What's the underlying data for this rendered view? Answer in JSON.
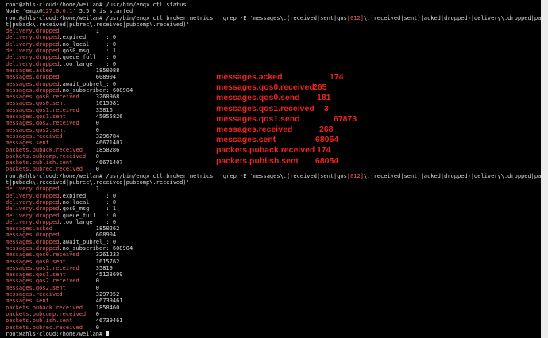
{
  "terminal": {
    "lines": [
      {
        "segs": [
          {
            "t": "root@ahls-cloud:/home/weilan# /usr/bin/emqx ctl status"
          }
        ]
      },
      {
        "segs": [
          {
            "t": "Node 'emqx@"
          },
          {
            "t": "127.0.0.1",
            "c": "r"
          },
          {
            "t": "' 5.5.0 is started"
          }
        ]
      },
      {
        "segs": [
          {
            "t": "root@ahls-cloud:/home/weilan# /usr/bin/emqx ctl broker metrics | grep -E 'messages\\.(received|sent|qos"
          },
          {
            "t": "[012]",
            "c": "r"
          },
          {
            "t": "\\.(received|sent)|acked|dropped)|delivery\\.dropped|packets\\.(publish\\.sent|"
          }
        ]
      },
      {
        "segs": [
          {
            "t": "t|puback\\.received|pubrec\\.received|pubcomp\\.received)'"
          }
        ]
      },
      {
        "segs": [
          {
            "t": "delivery.dropped",
            "c": "r"
          },
          {
            "t": "         : 1"
          }
        ]
      },
      {
        "segs": [
          {
            "t": "delivery.dropped",
            "c": "r"
          },
          {
            "t": ".expired      : 0"
          }
        ]
      },
      {
        "segs": [
          {
            "t": "delivery.dropped",
            "c": "r"
          },
          {
            "t": ".no_local     : 0"
          }
        ]
      },
      {
        "segs": [
          {
            "t": "delivery.dropped",
            "c": "r"
          },
          {
            "t": ".qos0_msg     : 1"
          }
        ]
      },
      {
        "segs": [
          {
            "t": "delivery.dropped",
            "c": "r"
          },
          {
            "t": ".queue_full   : 0"
          }
        ]
      },
      {
        "segs": [
          {
            "t": "delivery.dropped",
            "c": "r"
          },
          {
            "t": ".too_large    : 0"
          }
        ]
      },
      {
        "segs": [
          {
            "t": "messages.acked",
            "c": "r"
          },
          {
            "t": "           : 1850088"
          }
        ]
      },
      {
        "segs": [
          {
            "t": "messages.dropped",
            "c": "r"
          },
          {
            "t": "         : 608904"
          }
        ]
      },
      {
        "segs": [
          {
            "t": "messages.dropped",
            "c": "r"
          },
          {
            "t": ".await_pubrel_: 0"
          }
        ]
      },
      {
        "segs": [
          {
            "t": "messages.dropped",
            "c": "r"
          },
          {
            "t": ".no_subscriber: 608904"
          }
        ]
      },
      {
        "segs": [
          {
            "t": "messages.qos0.received",
            "c": "r"
          },
          {
            "t": "   : 3260968"
          }
        ]
      },
      {
        "segs": [
          {
            "t": "messages.qos0.sent",
            "c": "r"
          },
          {
            "t": "       : 1615581"
          }
        ]
      },
      {
        "segs": [
          {
            "t": "messages.qos1.received",
            "c": "r"
          },
          {
            "t": "   : 35816"
          }
        ]
      },
      {
        "segs": [
          {
            "t": "messages.qos1.sent",
            "c": "r"
          },
          {
            "t": "       : 45055826"
          }
        ]
      },
      {
        "segs": [
          {
            "t": "messages.qos2.received",
            "c": "r"
          },
          {
            "t": "   : 0"
          }
        ]
      },
      {
        "segs": [
          {
            "t": "messages.qos2.sent",
            "c": "r"
          },
          {
            "t": "       : 0"
          }
        ]
      },
      {
        "segs": [
          {
            "t": "messages.received",
            "c": "r"
          },
          {
            "t": "        : 3296784"
          }
        ]
      },
      {
        "segs": [
          {
            "t": "messages.sent",
            "c": "r"
          },
          {
            "t": "            : 46671407"
          }
        ]
      },
      {
        "segs": [
          {
            "t": "packets.puback.received",
            "c": "r"
          },
          {
            "t": "  : 1858286"
          }
        ]
      },
      {
        "segs": [
          {
            "t": "packets.pubcomp.received",
            "c": "r"
          },
          {
            "t": " : 0"
          }
        ]
      },
      {
        "segs": [
          {
            "t": "packets.publish.sent",
            "c": "r"
          },
          {
            "t": "     : 46671407"
          }
        ]
      },
      {
        "segs": [
          {
            "t": "packets.pubrec.received",
            "c": "r"
          },
          {
            "t": "  : 0"
          }
        ]
      },
      {
        "segs": [
          {
            "t": "root@ahls-cloud:/home/weilan# /usr/bin/emqx ctl broker metrics | grep -E 'messages\\.(received|sent|qos"
          },
          {
            "t": "[012]",
            "c": "r"
          },
          {
            "t": "\\.(received|sent)|acked|dropped)|delivery\\.dropped|packets\\.(publish\\.sent|"
          }
        ]
      },
      {
        "segs": [
          {
            "t": "t|puback\\.received|pubrec\\.received|pubcomp\\.received)'"
          }
        ]
      },
      {
        "segs": [
          {
            "t": "delivery.dropped",
            "c": "r"
          },
          {
            "t": "         : 1"
          }
        ]
      },
      {
        "segs": [
          {
            "t": "delivery.dropped",
            "c": "r"
          },
          {
            "t": ".expired      : 0"
          }
        ]
      },
      {
        "segs": [
          {
            "t": "delivery.dropped",
            "c": "r"
          },
          {
            "t": ".no_local     : 0"
          }
        ]
      },
      {
        "segs": [
          {
            "t": "delivery.dropped",
            "c": "r"
          },
          {
            "t": ".qos0_msg     : 1"
          }
        ]
      },
      {
        "segs": [
          {
            "t": "delivery.dropped",
            "c": "r"
          },
          {
            "t": ".queue_full   : 0"
          }
        ]
      },
      {
        "segs": [
          {
            "t": "delivery.dropped",
            "c": "r"
          },
          {
            "t": ".too_large    : 0"
          }
        ]
      },
      {
        "segs": [
          {
            "t": "messages.acked",
            "c": "r"
          },
          {
            "t": "           : 1850262"
          }
        ]
      },
      {
        "segs": [
          {
            "t": "messages.dropped",
            "c": "r"
          },
          {
            "t": "         : 608904"
          }
        ]
      },
      {
        "segs": [
          {
            "t": "messages.dropped",
            "c": "r"
          },
          {
            "t": ".await_pubrel_: 0"
          }
        ]
      },
      {
        "segs": [
          {
            "t": "messages.dropped",
            "c": "r"
          },
          {
            "t": ".no_subscriber: 608904"
          }
        ]
      },
      {
        "segs": [
          {
            "t": "messages.qos0.received",
            "c": "r"
          },
          {
            "t": "   : 3261233"
          }
        ]
      },
      {
        "segs": [
          {
            "t": "messages.qos0.sent",
            "c": "r"
          },
          {
            "t": "       : 1615762"
          }
        ]
      },
      {
        "segs": [
          {
            "t": "messages.qos1.received",
            "c": "r"
          },
          {
            "t": "   : 35819"
          }
        ]
      },
      {
        "segs": [
          {
            "t": "messages.qos1.sent",
            "c": "r"
          },
          {
            "t": "       : 45123699"
          }
        ]
      },
      {
        "segs": [
          {
            "t": "messages.qos2.received",
            "c": "r"
          },
          {
            "t": "   : 0"
          }
        ]
      },
      {
        "segs": [
          {
            "t": "messages.qos2.sent",
            "c": "r"
          },
          {
            "t": "       : 0"
          }
        ]
      },
      {
        "segs": [
          {
            "t": "messages.received",
            "c": "r"
          },
          {
            "t": "        : 3297052"
          }
        ]
      },
      {
        "segs": [
          {
            "t": "messages.sent",
            "c": "r"
          },
          {
            "t": "            : 46739461"
          }
        ]
      },
      {
        "segs": [
          {
            "t": "packets.puback.received",
            "c": "r"
          },
          {
            "t": "  : 1858460"
          }
        ]
      },
      {
        "segs": [
          {
            "t": "packets.pubcomp.received",
            "c": "r"
          },
          {
            "t": " : 0"
          }
        ]
      },
      {
        "segs": [
          {
            "t": "packets.publish.sent",
            "c": "r"
          },
          {
            "t": "     : 46739461"
          }
        ]
      },
      {
        "segs": [
          {
            "t": "packets.pubrec.received",
            "c": "r"
          },
          {
            "t": "  : 0"
          }
        ]
      },
      {
        "segs": [
          {
            "t": "root@ahls-cloud:/home/weilan# "
          }
        ],
        "cursor": true
      }
    ]
  },
  "annotations": [
    {
      "label": "messages.acked",
      "value": "174"
    },
    {
      "label": "messages.qos0.received",
      "value": "265"
    },
    {
      "label": "messages.qos0.send",
      "value": "181"
    },
    {
      "label": "messages.qos1.received",
      "value": "3"
    },
    {
      "label": "messages.qos1.send",
      "value": "67873"
    },
    {
      "label": "messages.received",
      "value": "268"
    },
    {
      "label": "messages.sent",
      "value": "68054"
    },
    {
      "label": "packets.puback.received",
      "value": "174"
    },
    {
      "label": "packets.publish.sent",
      "value": "68054"
    }
  ],
  "colors": {
    "terminal_bg": "#000000",
    "terminal_text": "#d8d8d8",
    "highlight": "#e8625f",
    "annotation": "#ee2222"
  }
}
